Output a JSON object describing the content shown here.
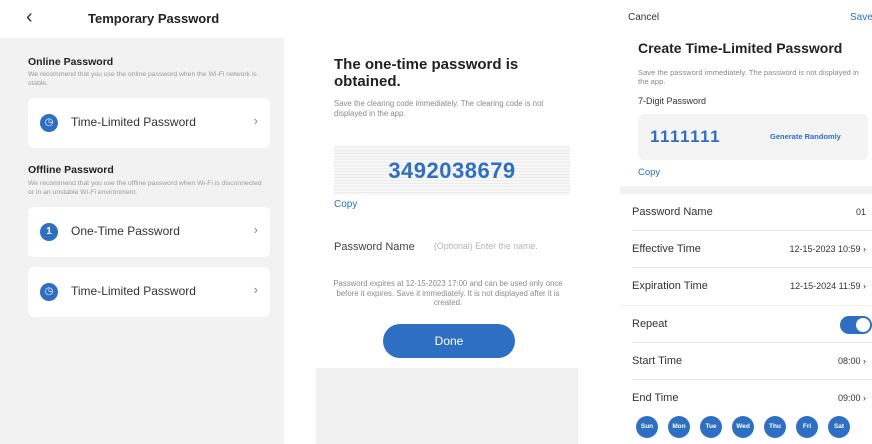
{
  "panel1": {
    "back_icon": "chevron-left-icon",
    "title": "Temporary Password",
    "online": {
      "title": "Online Password",
      "desc": "We recommend that you use the online password when the Wi-Fi network is stable.",
      "items": [
        {
          "label": "Time-Limited Password",
          "icon": "clock-icon",
          "icon_glyph": "◷"
        }
      ]
    },
    "offline": {
      "title": "Offline Password",
      "desc": "We recommend that you use the offline password when Wi-Fi is disconnected or in an unstable Wi-Fi environment.",
      "items": [
        {
          "label": "One-Time Password",
          "icon": "one-icon",
          "icon_glyph": "1"
        },
        {
          "label": "Time-Limited Password",
          "icon": "clock-icon",
          "icon_glyph": "◷"
        }
      ]
    },
    "chevron": "›"
  },
  "panel2": {
    "heading": "The one-time password is obtained.",
    "subtext": "Save the clearing code immediately. The clearing code is not displayed in the app.",
    "code": "3492038679",
    "copy": "Copy",
    "name_label": "Password Name",
    "name_placeholder": "(Optional) Enter the name.",
    "note": "Password expires at 12-15-2023 17:00 and can be used only once before it expires. Save it immediately. It is not displayed after it is created.",
    "done": "Done"
  },
  "panel3": {
    "cancel": "Cancel",
    "save": "Save",
    "heading": "Create Time-Limited Password",
    "desc": "Save the password immediately. The password is not displayed in the app.",
    "digits_label": "7-Digit Password",
    "password": "1111111",
    "generate": "Generate Randomly",
    "copy": "Copy",
    "rows": [
      {
        "label": "Password Name",
        "value": "01"
      },
      {
        "label": "Effective Time",
        "value": "12-15-2023 10:59 ›"
      },
      {
        "label": "Expiration Time",
        "value": "12-15-2024 11:59 ›"
      }
    ],
    "repeat": {
      "label": "Repeat",
      "on": true
    },
    "start": {
      "label": "Start Time",
      "value": "08:00 ›"
    },
    "end": {
      "label": "End Time",
      "value": "09:00 ›"
    },
    "days": [
      "Sun",
      "Mon",
      "Tue",
      "Wed",
      "Thu",
      "Fri",
      "Sat"
    ]
  },
  "colors": {
    "accent": "#2e6fc2",
    "panel_bg": "#f2f2f2"
  }
}
